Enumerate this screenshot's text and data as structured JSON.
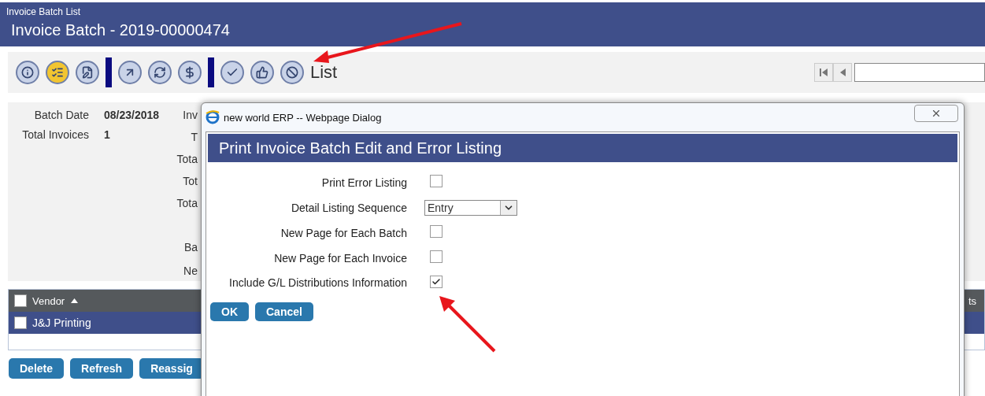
{
  "header": {
    "breadcrumb": "Invoice Batch List",
    "title": "Invoice Batch - 2019-00000474"
  },
  "toolbar": {
    "label": "List"
  },
  "batch_form": {
    "fields": [
      {
        "label": "Batch Date",
        "value": "08/23/2018"
      },
      {
        "label": "Total Invoices",
        "value": "1"
      }
    ],
    "column_2_labels": [
      "Inv",
      "T",
      "Tota",
      "Tot",
      "Tota",
      "Ba",
      "Ne"
    ]
  },
  "grid": {
    "all_checked": false,
    "columns": [
      {
        "label": "Vendor",
        "sorted_ascending": true
      },
      {
        "label": "ts"
      }
    ],
    "rows": [
      {
        "vendor": "J&J Printing",
        "checked": false,
        "selected": true
      }
    ]
  },
  "actions": [
    "Delete",
    "Refresh",
    "Reassig"
  ],
  "dialog": {
    "window_title": "new world ERP -- Webpage Dialog",
    "heading": "Print Invoice Batch Edit and Error Listing",
    "fields": [
      {
        "kind": "checkbox",
        "label": "Print Error Listing",
        "checked": false
      },
      {
        "kind": "select",
        "label": "Detail Listing Sequence",
        "value": "Entry"
      },
      {
        "kind": "checkbox",
        "label": "New Page for Each Batch",
        "checked": false
      },
      {
        "kind": "checkbox",
        "label": "New Page for Each Invoice",
        "checked": false
      },
      {
        "kind": "checkbox",
        "label": "Include G/L Distributions Information",
        "checked": true
      }
    ],
    "buttons": [
      "OK",
      "Cancel"
    ]
  }
}
